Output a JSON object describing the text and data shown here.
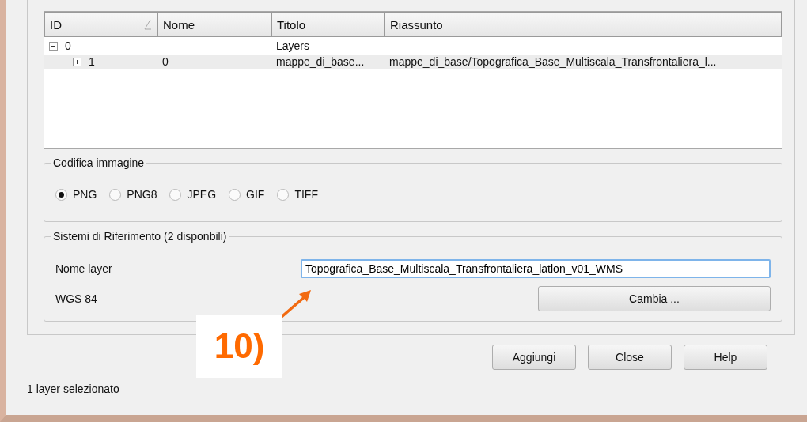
{
  "table": {
    "columns": [
      {
        "label": "ID",
        "sorted": true
      },
      {
        "label": "Nome",
        "sorted": false
      },
      {
        "label": "Titolo",
        "sorted": false
      },
      {
        "label": "Riassunto",
        "sorted": false
      }
    ],
    "rows": [
      {
        "id": "0",
        "titolo": "Layers",
        "expanded": true,
        "selected": false,
        "children": [
          {
            "id": "1",
            "nome": "0",
            "titolo": "mappe_di_base...",
            "riassunto": "mappe_di_base/Topografica_Base_Multiscala_Transfrontaliera_l...",
            "expanded": false,
            "selected": true
          }
        ]
      }
    ]
  },
  "encoding": {
    "title": "Codifica immagine",
    "options": [
      {
        "label": "PNG",
        "selected": true
      },
      {
        "label": "PNG8",
        "selected": false
      },
      {
        "label": "JPEG",
        "selected": false
      },
      {
        "label": "GIF",
        "selected": false
      },
      {
        "label": "TIFF",
        "selected": false
      }
    ]
  },
  "crs": {
    "title": "Sistemi di Riferimento (2 disponbili)",
    "layer_name_label": "Nome layer",
    "layer_name_value": "Topografica_Base_Multiscala_Transfrontaliera_latlon_v01_WMS",
    "crs_label": "WGS 84",
    "change_button": "Cambia ..."
  },
  "buttons": [
    "Aggiungi",
    "Close",
    "Help"
  ],
  "status_bar": "1 layer selezionato",
  "annotation": {
    "label": "10)"
  }
}
